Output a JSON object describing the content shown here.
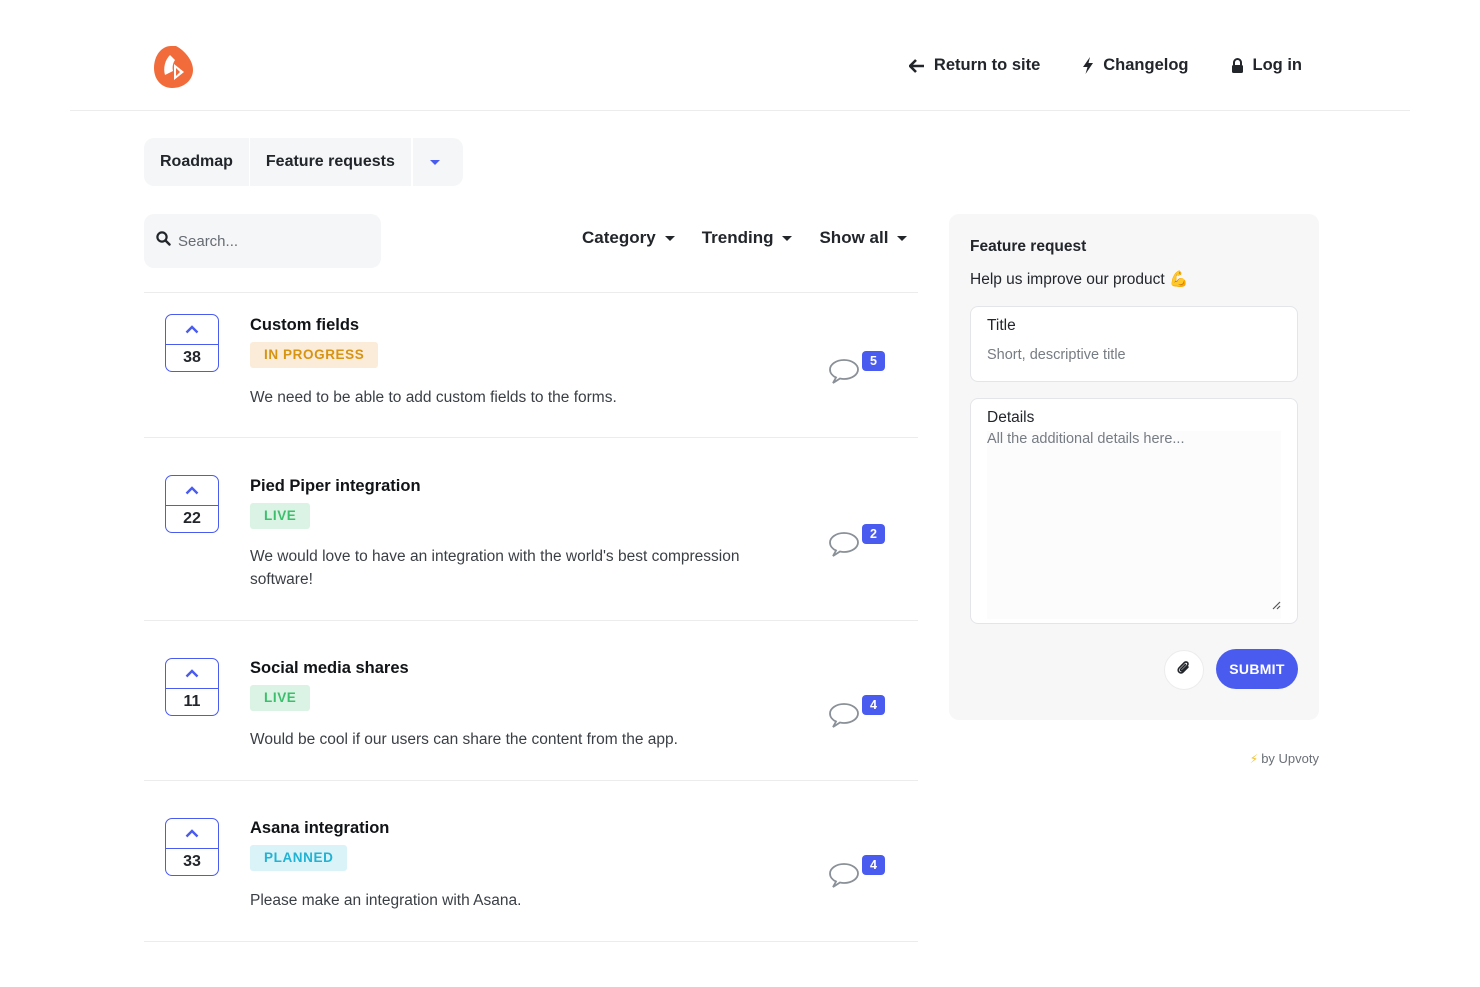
{
  "header": {
    "logo_icon": "upvoty-logo-icon",
    "nav": [
      {
        "label": "Return to site",
        "icon": "arrow-left-icon"
      },
      {
        "label": "Changelog",
        "icon": "bolt-icon"
      },
      {
        "label": "Log in",
        "icon": "lock-icon"
      }
    ]
  },
  "tabs": {
    "items": [
      "Roadmap",
      "Feature requests"
    ],
    "dropdown_icon": "chevron-down-icon"
  },
  "search": {
    "placeholder": "Search...",
    "value": ""
  },
  "filters": [
    "Category",
    "Trending",
    "Show all"
  ],
  "posts": [
    {
      "title": "Custom fields",
      "status": "IN PROGRESS",
      "votes": "38",
      "description": "We need to be able to add custom fields to the forms.",
      "comments": "5"
    },
    {
      "title": "Pied Piper integration",
      "status": "LIVE",
      "votes": "22",
      "description": "We would love to have an integration with the world's best compression software!",
      "comments": "2"
    },
    {
      "title": "Social media shares",
      "status": "LIVE",
      "votes": "11",
      "description": "Would be cool if our users can share the content from the app.",
      "comments": "4"
    },
    {
      "title": "Asana integration",
      "status": "PLANNED",
      "votes": "33",
      "description": "Please make an integration with Asana.",
      "comments": "4"
    }
  ],
  "panel": {
    "title": "Feature request",
    "subtitle": "Help us improve our product 💪",
    "title_field": {
      "label": "Title",
      "placeholder": "Short, descriptive title"
    },
    "details_field": {
      "label": "Details",
      "placeholder": "All the additional details here..."
    },
    "submit_label": "SUBMIT",
    "attach_icon": "paperclip-icon"
  },
  "footer": {
    "powered_by": "by Upvoty"
  },
  "colors": {
    "accent": "#4a5bf0",
    "brand": "#f26b3a",
    "in_progress_bg": "#fbecd9",
    "in_progress_text": "#d79312",
    "live_bg": "#dbf3e4",
    "live_text": "#3cbf6c",
    "planned_bg": "#d9f3f9",
    "planned_text": "#22b2d3"
  }
}
